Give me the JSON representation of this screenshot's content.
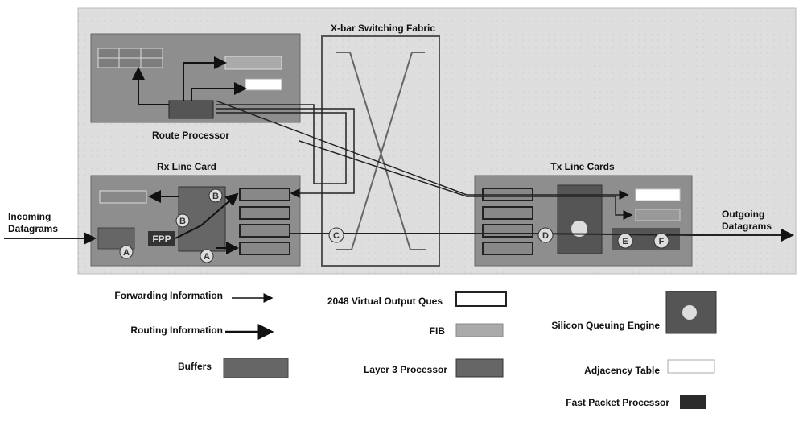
{
  "title": "X-bar Switching Fabric",
  "labels": {
    "route_processor": "Route Processor",
    "rx_line_card": "Rx Line Card",
    "tx_line_cards": "Tx Line Cards",
    "incoming_1": "Incoming",
    "incoming_2": "Datagrams",
    "outgoing_1": "Outgoing",
    "outgoing_2": "Datagrams",
    "fpp": "FPP"
  },
  "markers": {
    "rx_b1": "B",
    "rx_b2": "B",
    "rx_a1": "A",
    "rx_a2": "A",
    "c": "C",
    "d": "D",
    "e": "E",
    "f": "F"
  },
  "legend": {
    "forwarding": "Forwarding Information",
    "routing": "Routing Information",
    "buffers": "Buffers",
    "voq": "2048 Virtual Output Ques",
    "fib": "FIB",
    "l3": "Layer 3 Processor",
    "sqe": "Silicon Queuing Engine",
    "adj": "Adjacency Table",
    "fpp": "Fast Packet Processor"
  },
  "colors": {
    "panel": "#dcdcdc",
    "card": "#8a8a8a",
    "dark": "#333333"
  }
}
